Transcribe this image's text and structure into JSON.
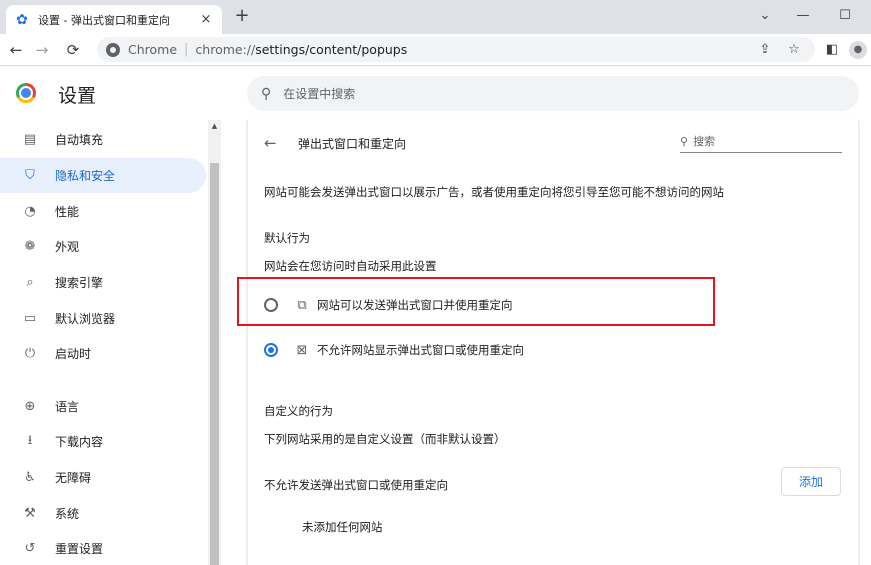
{
  "tab": {
    "title": "设置 - 弹出式窗口和重定向",
    "close": "×"
  },
  "newtab": "+",
  "window": {
    "minimize": "—",
    "maximize": "☐",
    "collapse": "⌄"
  },
  "nav": {
    "back": "←",
    "forward": "→",
    "reload": "⟳"
  },
  "omnibox": {
    "host": "Chrome",
    "separator": "|",
    "scheme": "chrome://",
    "path": "settings/content/popups"
  },
  "toolbar_icons": {
    "share": "⇪",
    "star": "☆",
    "sidepanel": "◧",
    "profile": "●"
  },
  "settings": {
    "title": "设置",
    "search_placeholder": "在设置中搜索"
  },
  "sidebar": {
    "items": [
      {
        "label": "自动填充",
        "icon": "▤"
      },
      {
        "label": "隐私和安全",
        "icon": "⛉"
      },
      {
        "label": "性能",
        "icon": "◔"
      },
      {
        "label": "外观",
        "icon": "❁"
      },
      {
        "label": "搜索引擎",
        "icon": "⌕"
      },
      {
        "label": "默认浏览器",
        "icon": "▭"
      },
      {
        "label": "启动时",
        "icon": "⏻"
      },
      {
        "label": "语言",
        "icon": "⊕"
      },
      {
        "label": "下载内容",
        "icon": "⭳"
      },
      {
        "label": "无障碍",
        "icon": "♿"
      },
      {
        "label": "系统",
        "icon": "⚒"
      },
      {
        "label": "重置设置",
        "icon": "↺"
      }
    ],
    "active_index": 1
  },
  "scroll_up": "▲",
  "content": {
    "back": "←",
    "title": "弹出式窗口和重定向",
    "search_placeholder": "搜索",
    "description": "网站可能会发送弹出式窗口以展示广告，或者使用重定向将您引导至您可能不想访问的网站",
    "default_heading": "默认行为",
    "default_sub": "网站会在您访问时自动采用此设置",
    "option_allow": "网站可以发送弹出式窗口并使用重定向",
    "option_block": "不允许网站显示弹出式窗口或使用重定向",
    "custom_heading": "自定义的行为",
    "custom_sub": "下列网站采用的是自定义设置（而非默认设置）",
    "block_list_label": "不允许发送弹出式窗口或使用重定向",
    "add_button": "添加",
    "empty_text": "未添加任何网站"
  },
  "colors": {
    "accent": "#1a73e8",
    "highlight": "#e3151d",
    "active_bg": "#e8f0fe"
  }
}
